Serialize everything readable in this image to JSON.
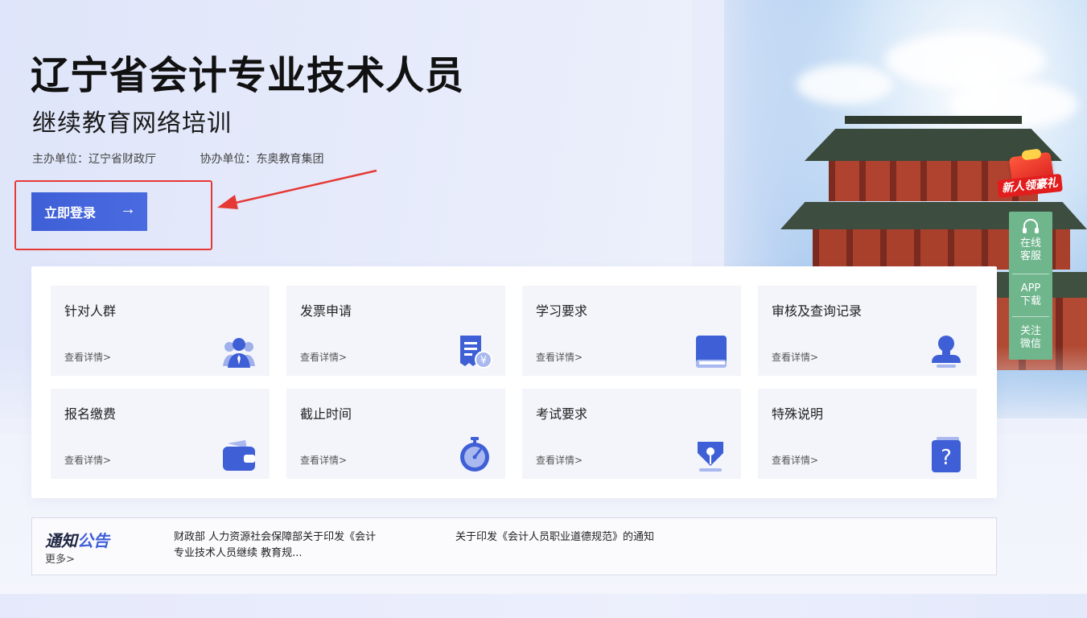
{
  "header": {
    "title": "辽宁省会计专业技术人员",
    "subtitle": "继续教育网络培训",
    "host": "主办单位：辽宁省财政厅",
    "co_host": "协办单位：东奥教育集团",
    "login_label": "立即登录",
    "login_arrow": "→"
  },
  "badge": {
    "label": "新人领豪礼"
  },
  "cards": [
    {
      "title": "针对人群",
      "detail": "查看详情>",
      "icon": "users-icon"
    },
    {
      "title": "发票申请",
      "detail": "查看详情>",
      "icon": "invoice-icon"
    },
    {
      "title": "学习要求",
      "detail": "查看详情>",
      "icon": "book-icon"
    },
    {
      "title": "审核及查询记录",
      "detail": "查看详情>",
      "icon": "stamp-icon"
    },
    {
      "title": "报名缴费",
      "detail": "查看详情>",
      "icon": "wallet-icon"
    },
    {
      "title": "截止时间",
      "detail": "查看详情>",
      "icon": "stopwatch-icon"
    },
    {
      "title": "考试要求",
      "detail": "查看详情>",
      "icon": "pen-nib-icon"
    },
    {
      "title": "特殊说明",
      "detail": "查看详情>",
      "icon": "question-icon"
    }
  ],
  "notice": {
    "title_a": "通知",
    "title_b": "公告",
    "more": "更多>",
    "items": [
      {
        "line1": "财政部 人力资源社会保障部关于印发《会计",
        "line2": "专业技术人员继续 教育规..."
      },
      {
        "line1": "关于印发《会计人员职业道德规范》的通知",
        "line2": ""
      }
    ]
  },
  "sidebar": {
    "items": [
      {
        "line1": "在线",
        "line2": "客服"
      },
      {
        "line1": "APP",
        "line2": "下载"
      },
      {
        "line1": "关注",
        "line2": "微信"
      }
    ]
  },
  "colors": {
    "primary": "#3e5fd6",
    "card_bg": "#f3f5fb",
    "sidebar": "#6fb68d",
    "highlight": "#e53935"
  }
}
